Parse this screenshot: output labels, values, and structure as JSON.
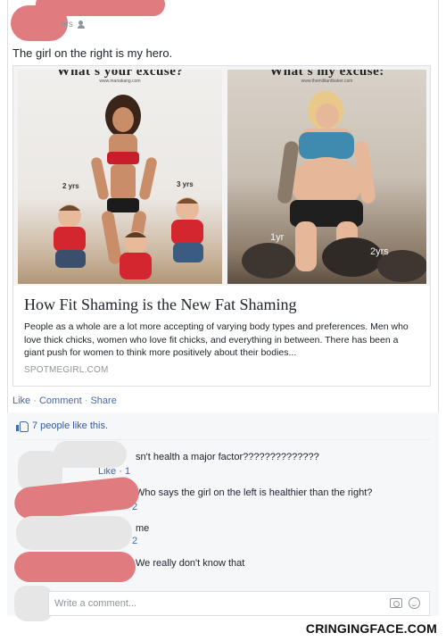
{
  "post": {
    "timestamp": "hrs",
    "privacy_icon": "friends-icon",
    "status_text": "The girl on the right is my hero."
  },
  "shared_link": {
    "image_left": {
      "title": "What's your excuse?",
      "url": "www.mariakang.com",
      "labels": [
        "2 yrs",
        "3 yrs"
      ]
    },
    "image_right": {
      "title": "What's my excuse:",
      "url": "www.themilitantbaker.com",
      "labels": [
        "1yr",
        "2yrs"
      ]
    },
    "title": "How Fit Shaming is the New Fat Shaming",
    "description": "People as a whole are a lot more accepting of varying body types and preferences. Men who love thick chicks, women who love fit chicks, and everything in between. There has been a giant push for women to think more positively about their bodies...",
    "source": "SPOTMEGIRL.COM"
  },
  "actions": {
    "like": "Like",
    "comment": "Comment",
    "share": "Share",
    "separator": "·"
  },
  "likes": {
    "text": "7 people like this."
  },
  "comments": [
    {
      "text": "sn't health a major factor??????????????",
      "sub": "Like · 1"
    },
    {
      "text": "Who says the girl on the left is healthier than the right?",
      "sub": "2"
    },
    {
      "text": "me",
      "sub": "2"
    },
    {
      "text": "We really don't know that",
      "sub": ""
    }
  ],
  "composer": {
    "placeholder": "Write a comment..."
  },
  "watermark": "CRINGINGFACE.COM",
  "colors": {
    "link_blue": "#4267b2",
    "redaction_pink": "#e07b7f",
    "redaction_gray": "#e6e6e6"
  }
}
